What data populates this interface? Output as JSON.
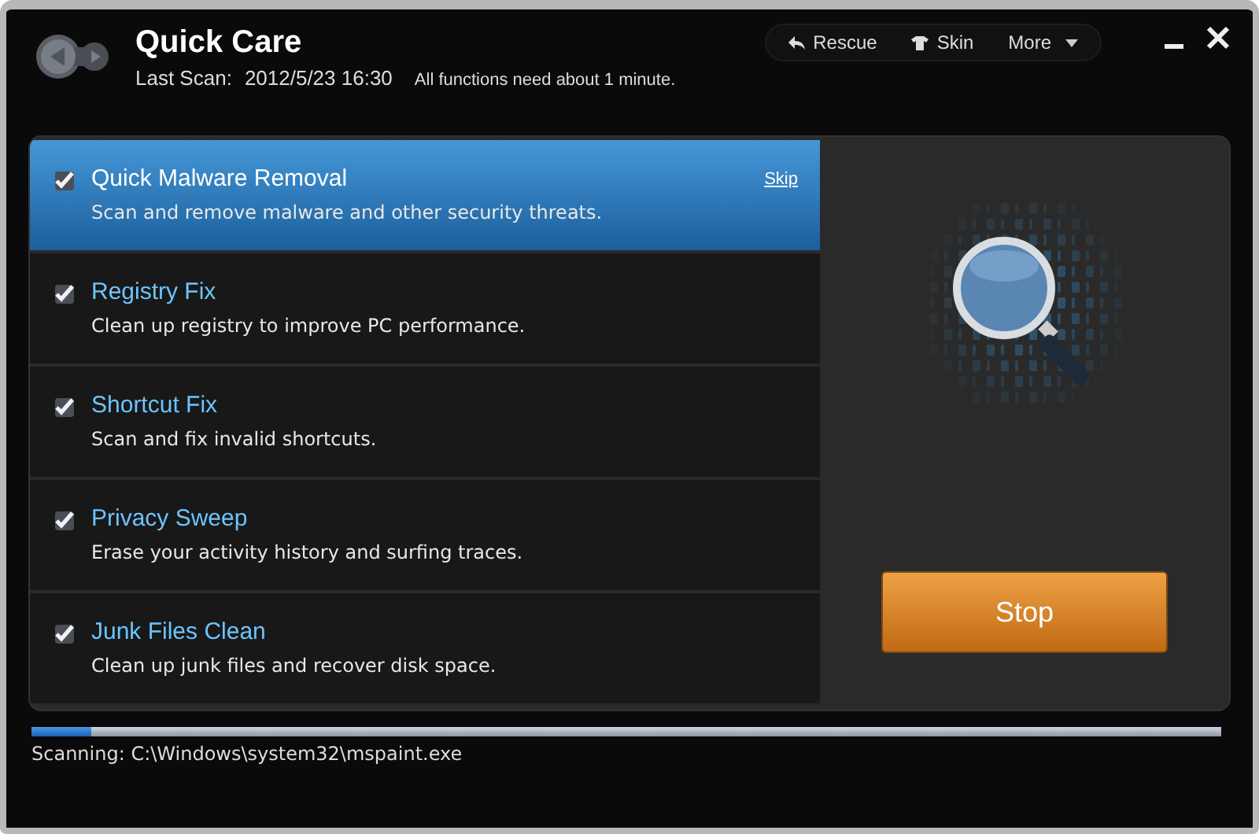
{
  "window": {
    "title": "Quick Care",
    "last_scan_label": "Last Scan:",
    "last_scan": "2012/5/23 16:30",
    "note": "All functions need about 1 minute."
  },
  "toolbar": [
    {
      "label": "Rescue",
      "kind": "rescue"
    },
    {
      "label": "Skin",
      "kind": "skin"
    },
    {
      "label": "More",
      "kind": "more"
    }
  ],
  "tasks": [
    {
      "title": "Quick Malware Removal",
      "description": "Scan and remove malware and other security threats.",
      "checked": true,
      "selected": true,
      "link": "Skip"
    },
    {
      "title": "Registry Fix",
      "description": "Clean up registry to improve PC performance.",
      "checked": true,
      "selected": false
    },
    {
      "title": "Shortcut Fix",
      "description": "Scan and fix invalid shortcuts.",
      "checked": true,
      "selected": false
    },
    {
      "title": "Privacy Sweep",
      "description": "Erase your activity history and surfing traces.",
      "checked": true,
      "selected": false
    },
    {
      "title": "Junk Files Clean",
      "description": "Clean up junk files and recover disk space.",
      "checked": true,
      "selected": false
    }
  ],
  "stop_button": "Stop",
  "progress": {
    "level": 0.05,
    "status": "Scanning: C:\\Windows\\system32\\mspaint.exe"
  }
}
